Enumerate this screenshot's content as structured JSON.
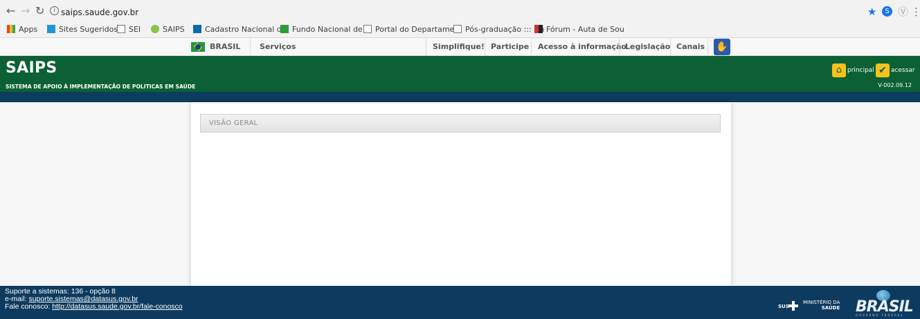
{
  "browser": {
    "url": "saips.saude.gov.br",
    "bookmarks": [
      "Apps",
      "Sites Sugeridos",
      "SEI",
      "SAIPS",
      "Cadastro Nacional d",
      "Fundo Nacional de S",
      "Portal do Departame",
      "Pós-graduação ::: Un",
      "Fórum - Auta de Sou"
    ]
  },
  "govbar": {
    "brand": "BRASIL",
    "services": "Serviços",
    "links": [
      "Simplifique!",
      "Participe",
      "Acesso à informação",
      "Legislação",
      "Canais"
    ]
  },
  "header": {
    "title": "SAIPS",
    "subtitle": "SISTEMA DE APOIO À IMPLEMENTAÇÃO DE POLITICAS EM SAÚDE",
    "principal": "principal",
    "acessar": "acessar",
    "version": "V-002.09.12"
  },
  "main": {
    "section_title": "VISÃO GERAL"
  },
  "footer": {
    "support": "Suporte a sistemas: 136 - opção 8",
    "email_label": "e-mail: ",
    "email": "suporte.sistemas@datasus.gov.br",
    "contact_label": "Fale conosco: ",
    "contact_url": "http://datasus.saude.gov.br/fale-conosco",
    "sus": "SUS",
    "ministry_line1": "MINISTÉRIO DA",
    "ministry_line2": "SAÚDE",
    "brasil_logo": "BRASIL",
    "brasil_sub": "GOVERNO FEDERAL"
  },
  "colors": {
    "header_green": "#0b6133",
    "footer_blue": "#0d3b5f"
  }
}
